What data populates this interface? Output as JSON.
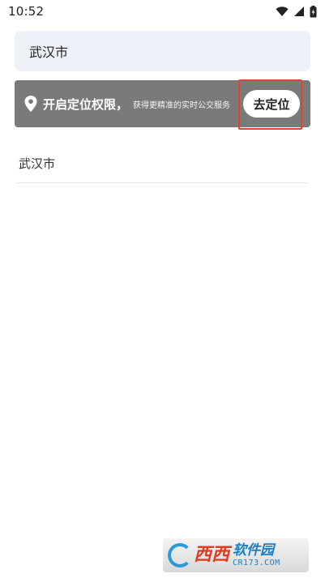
{
  "status_bar": {
    "time": "10:52",
    "icons": [
      "wifi-icon",
      "signal-icon",
      "battery-icon"
    ]
  },
  "search": {
    "value": "武汉市"
  },
  "banner": {
    "icon": "location-pin-icon",
    "title": "开启定位权限，",
    "subtitle": "获得更精准的实时公交服务",
    "button_label": "去定位",
    "background": "#7a7a7a",
    "highlight_color": "#e0442f"
  },
  "results": [
    {
      "label": "武汉市"
    }
  ],
  "watermark": {
    "red_text": "西西",
    "blue_text": "软件园",
    "url_text": "CR173.COM"
  }
}
